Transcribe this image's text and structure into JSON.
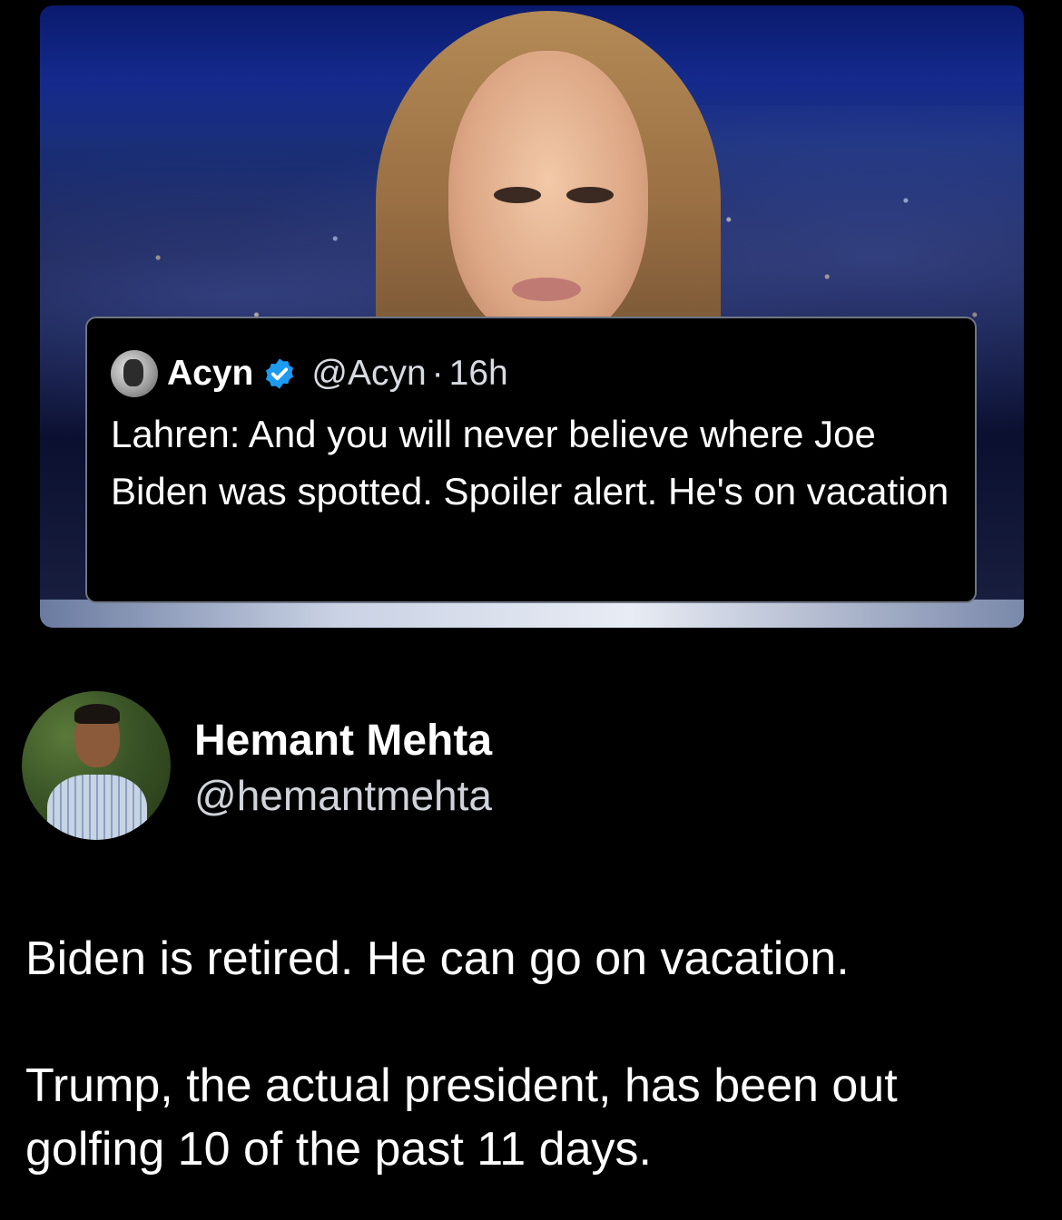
{
  "quoted_tweet": {
    "author_name": "Acyn",
    "handle": "@Acyn",
    "separator": "·",
    "time": "16h",
    "text": "Lahren: And you will never believe where Joe Biden was spotted. Spoiler alert. He's on vacation"
  },
  "tweet": {
    "author_name": "Hemant Mehta",
    "handle": "@hemantmehta",
    "paragraphs": [
      "Biden is retired. He can go on vacation.",
      "Trump, the actual president, has been out golfing 10 of the past 11 days."
    ]
  },
  "colors": {
    "background": "#000000",
    "verified_badge": "#1d9bf0",
    "handle_text": "#d0d4da"
  }
}
